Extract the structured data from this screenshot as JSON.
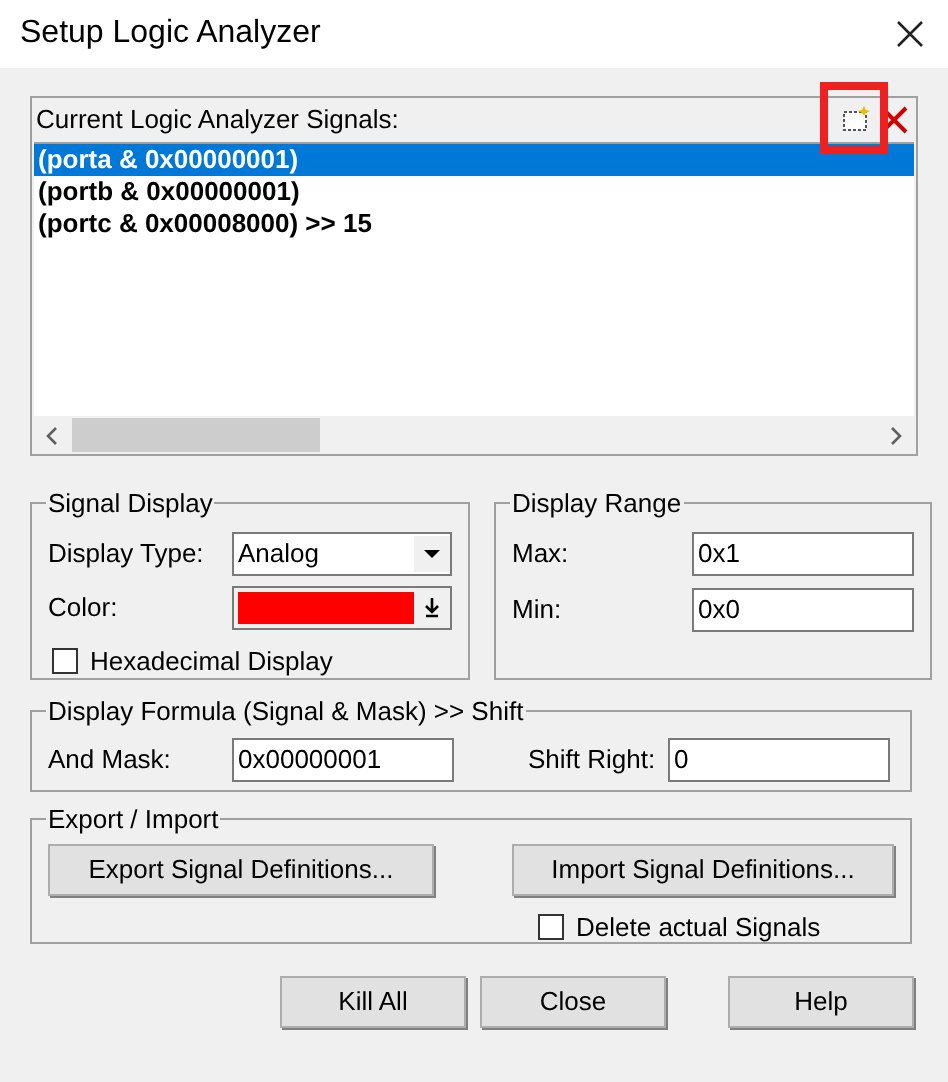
{
  "window": {
    "title": "Setup Logic Analyzer"
  },
  "signals": {
    "label": "Current Logic Analyzer Signals:",
    "items": [
      {
        "text": "(porta & 0x00000001)",
        "selected": true
      },
      {
        "text": "(portb & 0x00000001)",
        "selected": false
      },
      {
        "text": "(portc & 0x00008000) >> 15",
        "selected": false
      }
    ]
  },
  "signal_display": {
    "title": "Signal Display",
    "display_type": {
      "label": "Display Type:",
      "value": "Analog"
    },
    "color": {
      "label": "Color:",
      "color": "#ff0000"
    },
    "hexadecimal": {
      "label": "Hexadecimal Display",
      "checked": false
    }
  },
  "display_range": {
    "title": "Display Range",
    "max": {
      "label": "Max:",
      "value": "0x1"
    },
    "min": {
      "label": "Min:",
      "value": "0x0"
    }
  },
  "formula": {
    "title": "Display Formula (Signal & Mask) >> Shift",
    "and_mask": {
      "label": "And Mask:",
      "value": "0x00000001"
    },
    "shift_right": {
      "label": "Shift Right:",
      "value": "0"
    }
  },
  "export_import": {
    "title": "Export / Import",
    "export_button": "Export Signal Definitions...",
    "import_button": "Import Signal Definitions...",
    "delete_signals": {
      "label": "Delete actual Signals",
      "checked": false
    }
  },
  "buttons": [
    "Kill All",
    "Close",
    "Help"
  ]
}
